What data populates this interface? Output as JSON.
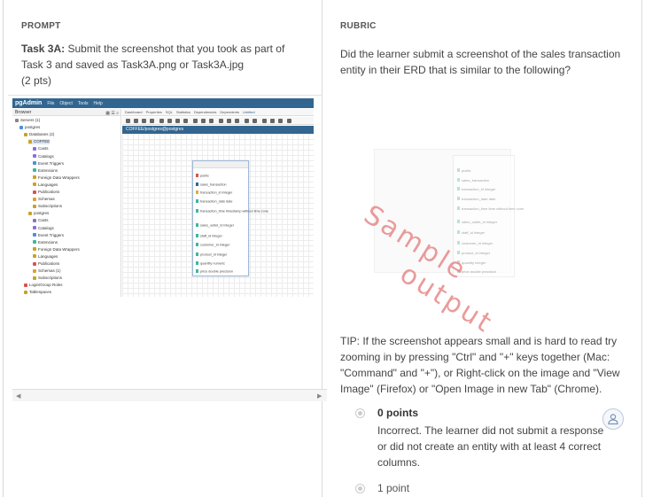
{
  "prompt": {
    "label": "PROMPT",
    "task_label": "Task 3A:",
    "task_text": "Submit the screenshot that you took as part of Task 3 and saved as Task3A.png or Task3A.jpg",
    "points": "(2 pts)"
  },
  "screenshot": {
    "app_logo": "pgAdmin",
    "menu": [
      "File",
      "Object",
      "Tools",
      "Help"
    ],
    "browser_title": "Browser",
    "tabs": [
      "Dashboard",
      "Properties",
      "SQL",
      "Statistics",
      "Dependencies",
      "Dependents",
      "Untitled"
    ],
    "canvas_path": "COFFEE/postgres@postgres",
    "tree": [
      "Servers (1)",
      "postgres",
      "Databases (2)",
      "COFFEE",
      "Casts",
      "Catalogs",
      "Event Triggers",
      "Extensions",
      "Foreign Data Wrappers",
      "Languages",
      "Publications",
      "Schemas",
      "Subscriptions",
      "postgres",
      "Casts",
      "Catalogs",
      "Event Triggers",
      "Extensions",
      "Foreign Data Wrappers",
      "Languages",
      "Publications",
      "Schemas (1)",
      "Subscriptions",
      "Login/Group Roles",
      "Tablespaces"
    ],
    "entity_rows": [
      "public",
      "sales_transaction",
      "transaction_id integer",
      "transaction_date date",
      "transaction_time timestamp without time zone",
      "sales_outlet_id integer",
      "staff_id integer",
      "customer_id integer",
      "product_id integer",
      "quantity numeric",
      "price double precision"
    ],
    "colors": {
      "header": "#326690",
      "accent": "#3cb89f"
    }
  },
  "rubric": {
    "label": "RUBRIC",
    "question": "Did the learner submit a screenshot of the sales transaction entity in their ERD that is similar to the following?",
    "sample_watermark_1": "Sample",
    "sample_watermark_2": "output",
    "sample_rows": [
      "public",
      "sales_transaction",
      "transaction_id integer",
      "transaction_date date",
      "transaction_time time without time zone",
      "sales_outlet_id integer",
      "staff_id integer",
      "customer_id integer",
      "product_id integer",
      "quantity integer",
      "price double precision"
    ],
    "tip": "TIP: If the screenshot appears small and is hard to read try zooming in by pressing \"Ctrl\" and \"+\" keys together (Mac: \"Command\" and \"+\"), or Right-click on the image and \"View Image\" (Firefox) or \"Open Image in new Tab\" (Chrome).",
    "options": [
      {
        "title": "0 points",
        "desc": "Incorrect. The learner did not submit a response or did not create an entity with at least 4 correct columns."
      },
      {
        "title": "1 point",
        "desc": ""
      }
    ]
  }
}
